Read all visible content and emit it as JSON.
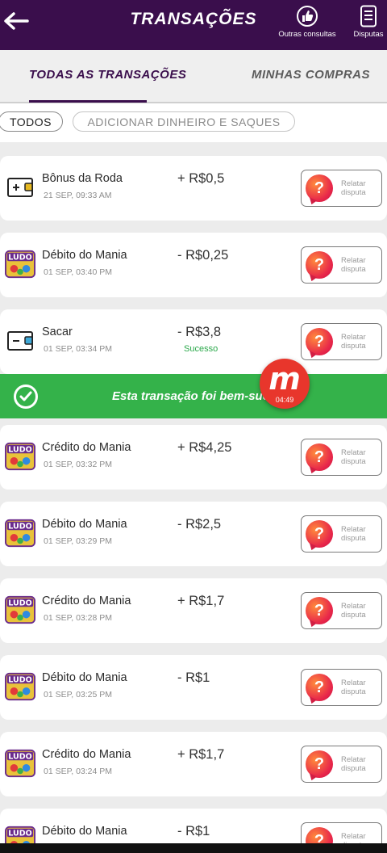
{
  "header": {
    "title": "TRANSAÇÕES",
    "actions": [
      {
        "label": "Outras consultas",
        "icon": "thumbs-up-icon"
      },
      {
        "label": "Disputas",
        "icon": "document-icon"
      }
    ]
  },
  "tabs": [
    {
      "label": "TODAS AS TRANSAÇÕES",
      "active": true
    },
    {
      "label": "MINHAS COMPRAS",
      "active": false
    }
  ],
  "filters": [
    {
      "label": "TODOS",
      "selected": true
    },
    {
      "label": "ADICIONAR DINHEIRO E SAQUES",
      "selected": false
    }
  ],
  "dispute_label": "Relatar disputa",
  "transactions": [
    {
      "name": "Bônus da Roda",
      "date": "21 SEP, 09:33 AM",
      "amount": "+ R$0,5",
      "status": "",
      "icon": "wallet-plus-icon"
    },
    {
      "name": "Débito do Mania",
      "date": "01 SEP, 03:40 PM",
      "amount": "- R$0,25",
      "status": "",
      "icon": "ludo-game-icon"
    },
    {
      "name": "Sacar",
      "date": "01 SEP, 03:34 PM",
      "amount": "- R$3,8",
      "status": "Sucesso",
      "icon": "wallet-minus-icon"
    },
    {
      "name": "Crédito do Mania",
      "date": "01 SEP, 03:32 PM",
      "amount": "+ R$4,25",
      "status": "",
      "icon": "ludo-game-icon"
    },
    {
      "name": "Débito do Mania",
      "date": "01 SEP, 03:29 PM",
      "amount": "- R$2,5",
      "status": "",
      "icon": "ludo-game-icon"
    },
    {
      "name": "Crédito do Mania",
      "date": "01 SEP, 03:28 PM",
      "amount": "+ R$1,7",
      "status": "",
      "icon": "ludo-game-icon"
    },
    {
      "name": "Débito do Mania",
      "date": "01 SEP, 03:25 PM",
      "amount": "- R$1",
      "status": "",
      "icon": "ludo-game-icon"
    },
    {
      "name": "Crédito do Mania",
      "date": "01 SEP, 03:24 PM",
      "amount": "+ R$1,7",
      "status": "",
      "icon": "ludo-game-icon"
    },
    {
      "name": "Débito do Mania",
      "date": "",
      "amount": "- R$1",
      "status": "",
      "icon": "ludo-game-icon"
    }
  ],
  "toast": {
    "message": "Esta transação foi bem-sucedida"
  },
  "recorder": {
    "time": "04:49"
  },
  "colors": {
    "header": "#3a0e4c",
    "success": "#34b24a",
    "dispute": "#e8274a"
  }
}
